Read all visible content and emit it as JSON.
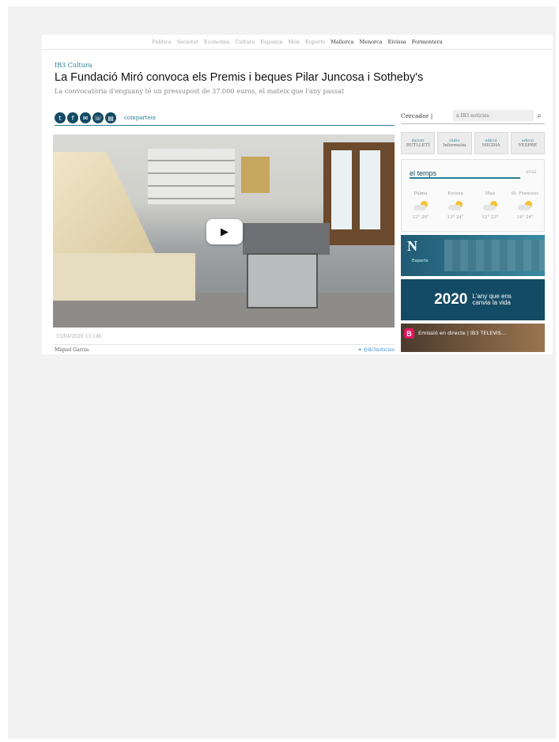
{
  "nav": {
    "items": [
      {
        "label": "Política",
        "dark": false
      },
      {
        "label": "Societat",
        "dark": false
      },
      {
        "label": "Economia",
        "dark": false
      },
      {
        "label": "Cultura",
        "dark": false
      },
      {
        "label": "Espanya",
        "dark": false
      },
      {
        "label": "Món",
        "dark": false
      },
      {
        "label": "Esports",
        "dark": false
      },
      {
        "label": "Mallorca",
        "dark": true
      },
      {
        "label": "Menorca",
        "dark": true
      },
      {
        "label": "Eivissa",
        "dark": true
      },
      {
        "label": "Formentera",
        "dark": true
      }
    ]
  },
  "article": {
    "section": "IB3 Cultura",
    "title": "La Fundació Miró convoca els Premis i beques Pilar Juncosa i Sotheby's",
    "subtitle": "La convocatòria d'enguany té un pressupost de 37.000 euros, el mateix que l'any passat",
    "share_label": "comparteix",
    "date": "15/04/2020 13:14h",
    "author": "Miquel Garcia",
    "twitter": "@ib3noticies"
  },
  "share_icons": [
    "twitter-icon",
    "facebook-icon",
    "email-icon",
    "whatsapp-icon",
    "print-icon"
  ],
  "sidebar": {
    "search_label": "Cercador |",
    "search_placeholder": "a IB3 notícies",
    "audio": [
      {
        "top": "darrer",
        "bottom": "BUTLLETÍ"
      },
      {
        "top": "ràdio",
        "bottom": "Informatiu"
      },
      {
        "top": "edició",
        "bottom": "MIGDIA"
      },
      {
        "top": "edició",
        "bottom": "VESPRE"
      }
    ],
    "weather": {
      "title": "el temps",
      "more": "avui",
      "cities": [
        {
          "name": "Palma",
          "temps": "12° 20°"
        },
        {
          "name": "Eivissa",
          "temps": "13° 24°"
        },
        {
          "name": "Maó",
          "temps": "12° 23°"
        },
        {
          "name": "St. Francesc",
          "temps": "14° 24°"
        }
      ]
    },
    "banner_sport": {
      "logo": "N",
      "label": "Esports"
    },
    "banner_2020": {
      "year": "2020",
      "line1": "L'any que ens",
      "line2": "canvia la vida"
    },
    "banner_tv": {
      "logo": "B",
      "text": "Emissió en directe | IB3 TELEVIS..."
    }
  }
}
